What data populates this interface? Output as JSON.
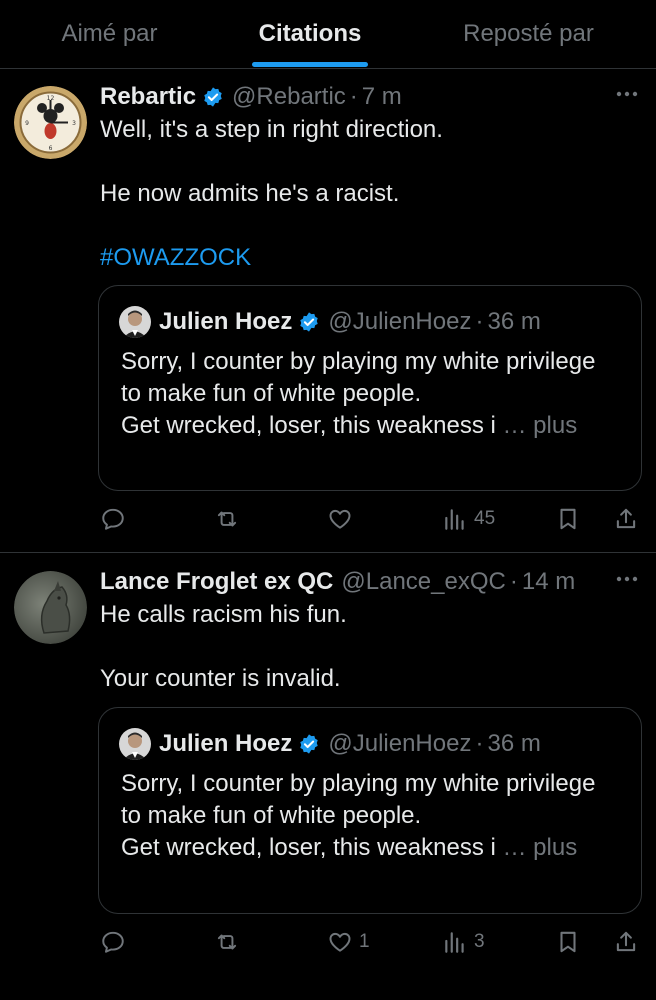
{
  "tabs": [
    {
      "label": "Aimé par",
      "active": false
    },
    {
      "label": "Citations",
      "active": true
    },
    {
      "label": "Reposté par",
      "active": false
    }
  ],
  "posts": [
    {
      "author": {
        "name": "Rebartic",
        "handle": "@Rebartic",
        "verified": true,
        "avatar": "mickey-clock-avatar"
      },
      "time": "7 m",
      "text_lines": [
        "Well, it's a step in right direction.",
        "He now admits he's a racist."
      ],
      "hashtag": "#OWAZZOCK",
      "quote": {
        "author": {
          "name": "Julien Hoez",
          "handle": "@JulienHoez",
          "verified": true
        },
        "time": "36 m",
        "lines": [
          "Sorry, I counter by playing my white privilege",
          "to make fun of white people.",
          "Get wrecked, loser, this weakness i"
        ],
        "more": "… plus"
      },
      "actions": {
        "replies": "",
        "reposts": "",
        "likes": "",
        "views": "45"
      }
    },
    {
      "author": {
        "name": "Lance Froglet ex QC",
        "handle": "@Lance_exQC",
        "verified": false,
        "avatar": "horse-painting-avatar"
      },
      "time": "14 m",
      "text_lines": [
        "He calls racism his fun.",
        "Your counter is invalid."
      ],
      "quote": {
        "author": {
          "name": "Julien Hoez",
          "handle": "@JulienHoez",
          "verified": true
        },
        "time": "36 m",
        "lines": [
          "Sorry, I counter by playing my white privilege",
          "to make fun of white people.",
          "Get wrecked, loser, this weakness i"
        ],
        "more": "… plus"
      },
      "actions": {
        "replies": "",
        "reposts": "",
        "likes": "1",
        "views": "3"
      }
    }
  ],
  "colors": {
    "accent": "#1d9bf0",
    "text": "#e7e9ea",
    "muted": "#71767b",
    "border": "#2f3336",
    "background": "#000000"
  }
}
